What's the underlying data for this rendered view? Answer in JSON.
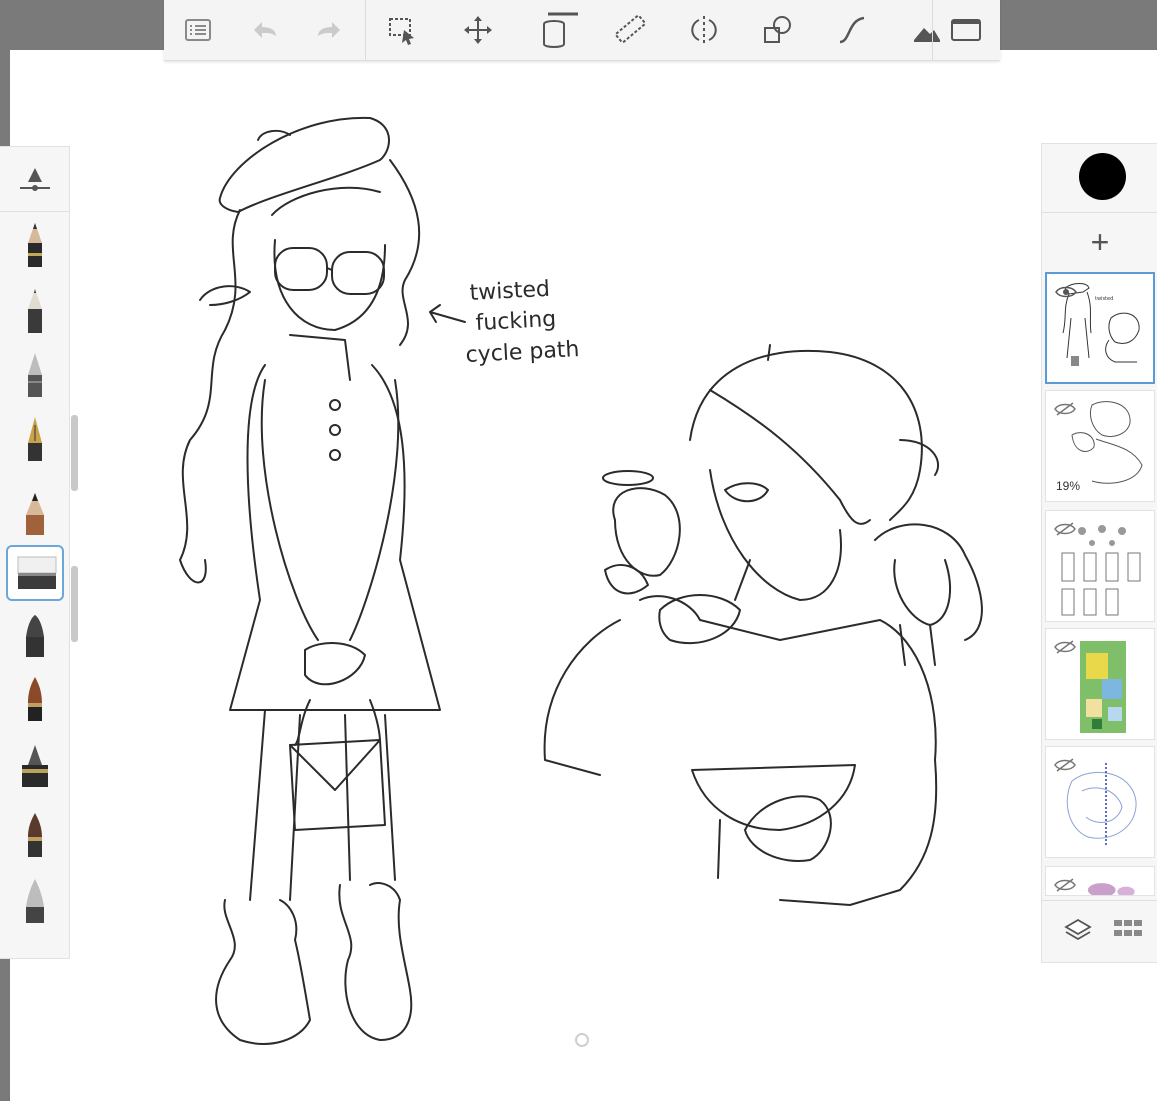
{
  "toolbar": {
    "icons": [
      "list-icon",
      "undo-icon",
      "redo-icon",
      "selection-icon",
      "move-transform-icon",
      "fill-bucket-icon",
      "ruler-icon",
      "symmetry-icon",
      "shapes-icon",
      "curve-icon",
      "image-insert-icon",
      "fullscreen-icon"
    ]
  },
  "canvas": {
    "annotation_lines": [
      "twisted",
      "fucking",
      "cycle path"
    ]
  },
  "brushes": {
    "items": [
      "pencil-brush",
      "fine-pencil-brush",
      "ballpoint-brush",
      "fountain-pen-brush",
      "chisel-brush",
      "eraser-brush",
      "marker-brush",
      "paintbrush-brush",
      "ink-pen-brush",
      "airbrush-brush",
      "smudge-brush"
    ],
    "selected": "eraser-brush"
  },
  "layers": {
    "color_swatch": "#000000",
    "add_label": "+",
    "items": [
      {
        "name": "layer-1",
        "hidden_icon": false,
        "active": true,
        "opacity": ""
      },
      {
        "name": "layer-2",
        "hidden_icon": true,
        "active": false,
        "opacity": "19%"
      },
      {
        "name": "layer-3",
        "hidden_icon": true,
        "active": false,
        "opacity": ""
      },
      {
        "name": "layer-4",
        "hidden_icon": true,
        "active": false,
        "opacity": ""
      },
      {
        "name": "layer-5",
        "hidden_icon": true,
        "active": false,
        "opacity": ""
      },
      {
        "name": "layer-6",
        "hidden_icon": true,
        "active": false,
        "opacity": ""
      }
    ],
    "footer_icons": [
      "layers-stack-icon",
      "grid-icon"
    ]
  },
  "colors": {
    "accent": "#5b9bd5",
    "panel_bg": "#f6f6f6",
    "ink": "#2a2a2a"
  }
}
